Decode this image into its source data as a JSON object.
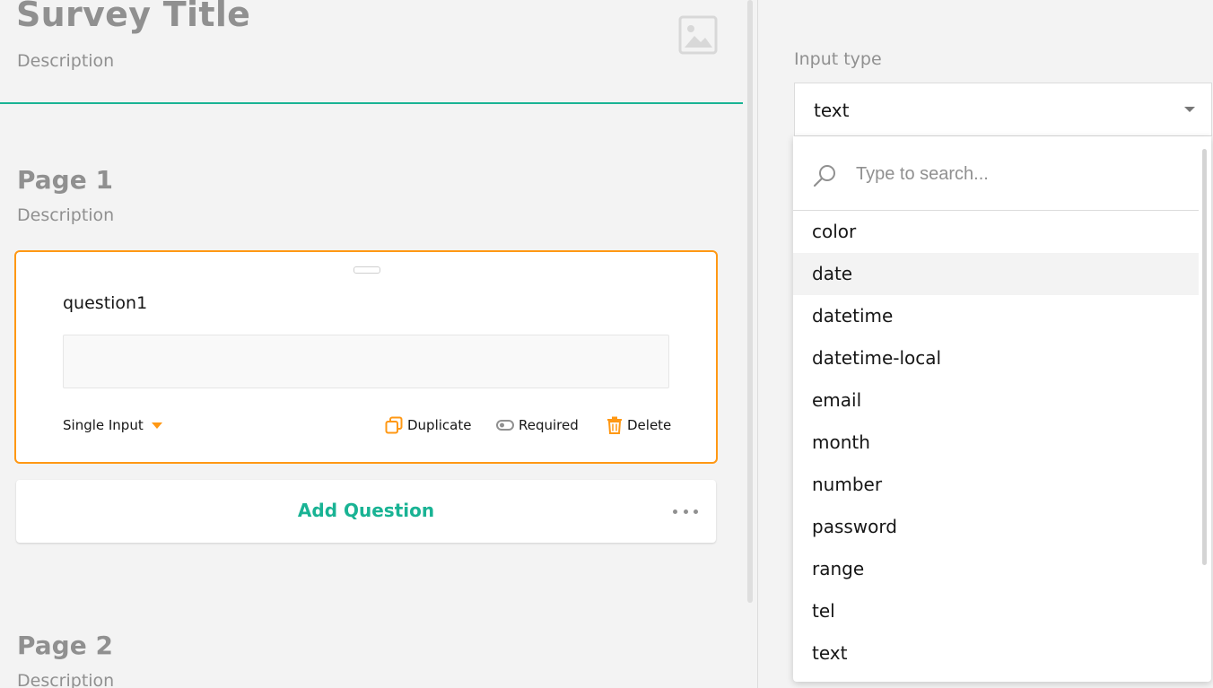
{
  "survey": {
    "title": "Survey Title",
    "description": "Description"
  },
  "pages": [
    {
      "title": "Page 1",
      "description": "Description"
    },
    {
      "title": "Page 2",
      "description": "Description"
    }
  ],
  "question": {
    "title": "question1",
    "type_label": "Single Input",
    "actions": {
      "duplicate": "Duplicate",
      "required": "Required",
      "delete": "Delete"
    }
  },
  "add_question": {
    "label": "Add Question"
  },
  "property_panel": {
    "input_type_label": "Input type",
    "input_type_value": "text",
    "search_placeholder": "Type to search...",
    "options": [
      "color",
      "date",
      "datetime",
      "datetime-local",
      "email",
      "month",
      "number",
      "password",
      "range",
      "tel",
      "text"
    ],
    "hovered_option": "date"
  },
  "colors": {
    "accent": "#19b394",
    "selection": "#ff9814",
    "muted_text": "#909090"
  },
  "icons": {
    "logo": "image-placeholder-icon",
    "type_dropdown": "triangle-down-icon",
    "duplicate": "duplicate-icon",
    "required": "toggle-icon",
    "delete": "trash-icon",
    "more": "more-horizontal-icon",
    "search": "search-icon",
    "select_caret": "chevron-down-icon"
  }
}
